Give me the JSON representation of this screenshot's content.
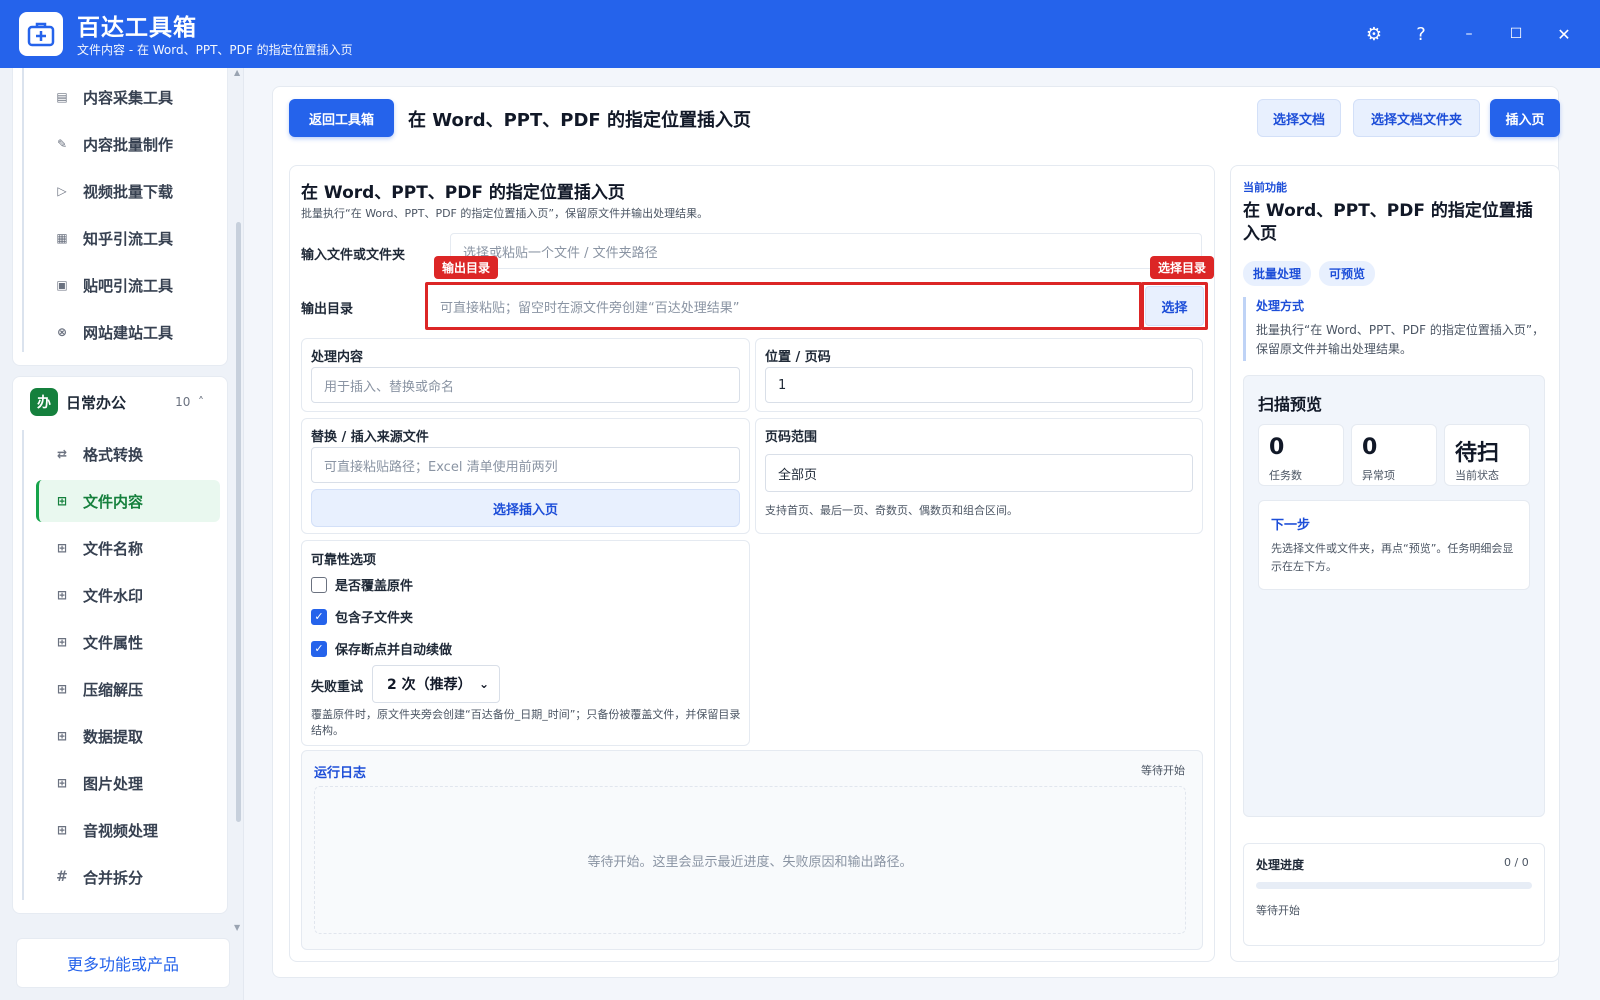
{
  "app": {
    "title": "百达工具箱",
    "subtitle": "文件内容 - 在 Word、PPT、PDF 的指定位置插入页"
  },
  "window": {
    "settings": "⚙",
    "help": "?",
    "minimize": "–",
    "maximize": "☐",
    "close": "✕"
  },
  "sidebar": {
    "top_items": [
      {
        "label": "内容采集工具",
        "icon": "collect-icon"
      },
      {
        "label": "内容批量制作",
        "icon": "pen-icon"
      },
      {
        "label": "视频批量下载",
        "icon": "video-icon"
      },
      {
        "label": "知乎引流工具",
        "icon": "zhihu-icon"
      },
      {
        "label": "贴吧引流工具",
        "icon": "tieba-icon"
      },
      {
        "label": "网站建站工具",
        "icon": "website-icon"
      }
    ],
    "group": {
      "badge": "办",
      "title": "日常办公",
      "count": "10",
      "caret": "˄"
    },
    "group_items": [
      {
        "label": "格式转换",
        "icon": "swap-icon"
      },
      {
        "label": "文件内容",
        "icon": "grid-icon",
        "active": true
      },
      {
        "label": "文件名称",
        "icon": "grid-icon"
      },
      {
        "label": "文件水印",
        "icon": "grid-icon"
      },
      {
        "label": "文件属性",
        "icon": "grid-icon"
      },
      {
        "label": "压缩解压",
        "icon": "grid-icon"
      },
      {
        "label": "数据提取",
        "icon": "grid-icon"
      },
      {
        "label": "图片处理",
        "icon": "grid-icon"
      },
      {
        "label": "音视频处理",
        "icon": "grid-icon"
      },
      {
        "label": "合并拆分",
        "icon": "hash-icon"
      }
    ],
    "more_label": "更多功能或产品"
  },
  "toolbar": {
    "back_label": "返回工具箱",
    "title": "在 Word、PPT、PDF 的指定位置插入页",
    "select_doc": "选择文档",
    "select_folder": "选择文档文件夹",
    "insert_page": "插入页"
  },
  "form": {
    "title": "在 Word、PPT、PDF 的指定位置插入页",
    "desc": "批量执行“在 Word、PPT、PDF 的指定位置插入页”，保留原文件并输出处理结果。",
    "input_label": "输入文件或文件夹",
    "input_placeholder": "选择或粘贴一个文件 / 文件夹路径",
    "output_label": "输出目录",
    "output_placeholder": "可直接粘贴；留空时在源文件旁创建“百达处理结果”",
    "output_tag": "输出目录",
    "choose_tag": "选择目录",
    "choose_button": "选择",
    "content_title": "处理内容",
    "content_placeholder": "用于插入、替换或命名",
    "position_title": "位置 / 页码",
    "position_value": "1",
    "source_title": "替换 / 插入来源文件",
    "source_placeholder": "可直接粘贴路径；Excel 清单使用前两列",
    "source_button": "选择插入页",
    "range_title": "页码范围",
    "range_value": "全部页",
    "range_hint": "支持首页、最后一页、奇数页、偶数页和组合区间。",
    "reliability_title": "可靠性选项",
    "options": [
      {
        "label": "是否覆盖原件",
        "checked": false
      },
      {
        "label": "包含子文件夹",
        "checked": true
      },
      {
        "label": "保存断点并自动续做",
        "checked": true
      }
    ],
    "retry_label": "失败重试",
    "retry_value": "2 次（推荐）",
    "reliability_hint": "覆盖原件时，原文件夹旁会创建“百达备份_日期_时间”；只备份被覆盖文件，并保留目录结构。",
    "log_title": "运行日志",
    "log_status": "等待开始",
    "log_empty": "等待开始。这里会显示最近进度、失败原因和输出路径。"
  },
  "right": {
    "current_label": "当前功能",
    "title": "在 Word、PPT、PDF 的指定位置插入页",
    "chips": [
      "批量处理",
      "可预览"
    ],
    "method_label": "处理方式",
    "method_desc": "批量执行“在 Word、PPT、PDF 的指定位置插入页”，保留原文件并输出处理结果。",
    "scan_title": "扫描预览",
    "stats": [
      {
        "value": "0",
        "label": "任务数"
      },
      {
        "value": "0",
        "label": "异常项"
      },
      {
        "value": "待扫",
        "label": "当前状态"
      }
    ],
    "next_title": "下一步",
    "next_desc": "先选择文件或文件夹，再点“预览”。任务明细会显示在左下方。",
    "progress_label": "处理进度",
    "progress_count": "0 / 0",
    "progress_fraction": 0,
    "progress_status": "等待开始"
  }
}
